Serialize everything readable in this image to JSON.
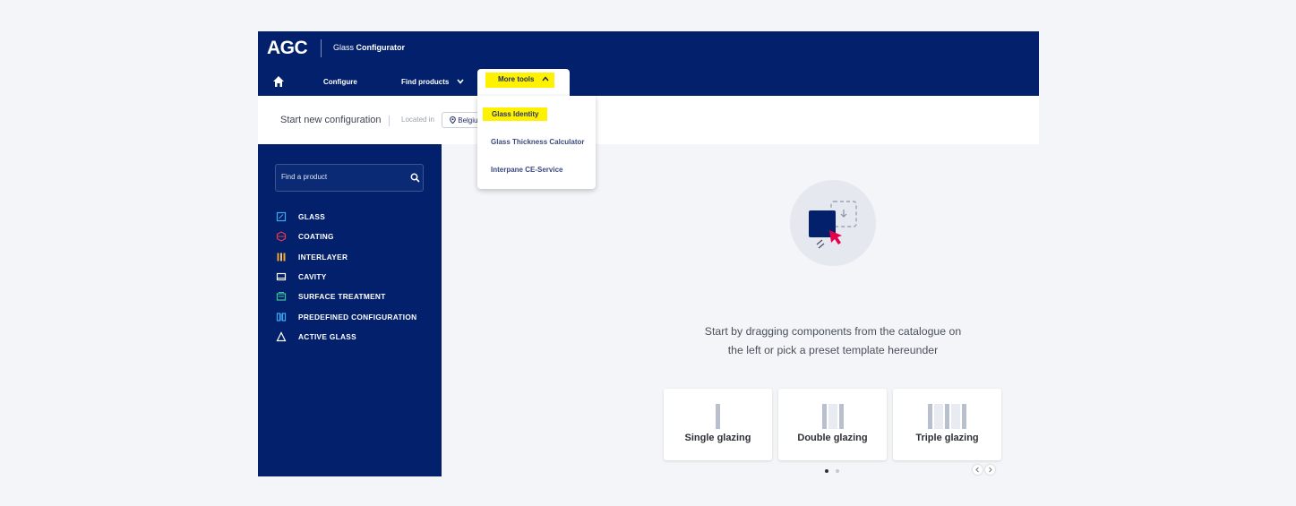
{
  "header": {
    "logo": "AGC",
    "app_title_prefix": "Glass ",
    "app_title_bold": "Configurator"
  },
  "nav": {
    "configure": "Configure",
    "find_products": "Find products",
    "more_tools": "More tools"
  },
  "config_bar": {
    "title": "Start new configuration",
    "located_label": "Located in",
    "location": "Belgium"
  },
  "more_tools_menu": [
    {
      "label": "Glass Identity",
      "highlighted": true
    },
    {
      "label": "Glass Thickness Calculator",
      "highlighted": false
    },
    {
      "label": "Interpane CE-Service",
      "highlighted": false
    }
  ],
  "sidebar": {
    "search_placeholder": "Find a product",
    "categories": [
      {
        "label": "GLASS",
        "icon": "glass-icon",
        "color": "#3fa9f5"
      },
      {
        "label": "COATING",
        "icon": "coating-icon",
        "color": "#e8384f"
      },
      {
        "label": "INTERLAYER",
        "icon": "interlayer-icon",
        "color": "#f5a623"
      },
      {
        "label": "CAVITY",
        "icon": "cavity-icon",
        "color": "#ffffff"
      },
      {
        "label": "SURFACE TREATMENT",
        "icon": "surface-treatment-icon",
        "color": "#3cc79b"
      },
      {
        "label": "PREDEFINED CONFIGURATION",
        "icon": "predefined-configuration-icon",
        "color": "#3fa9f5"
      },
      {
        "label": "ACTIVE GLASS",
        "icon": "active-glass-icon",
        "color": "#ffffff"
      }
    ]
  },
  "main": {
    "prompt": "Start by dragging components from the catalogue on the left or pick a preset template hereunder",
    "templates": [
      {
        "label": "Single glazing",
        "panes": 1
      },
      {
        "label": "Double glazing",
        "panes": 2
      },
      {
        "label": "Triple glazing",
        "panes": 3
      }
    ],
    "carousel_active_page": 1,
    "carousel_pages": 2
  },
  "colors": {
    "brand_navy": "#02206b",
    "highlight_yellow": "#fff200",
    "accent_pink": "#e6004c"
  }
}
